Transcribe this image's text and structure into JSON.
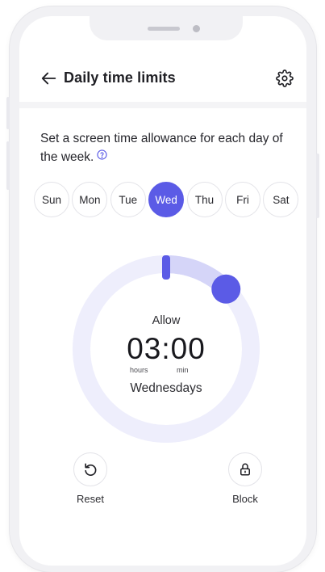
{
  "header": {
    "title": "Daily time limits",
    "back_icon": "arrow-left-icon",
    "settings_icon": "gear-icon"
  },
  "description": {
    "text": "Set a screen time allowance for each day of the week.",
    "help_icon": "question-circle-icon"
  },
  "days": [
    {
      "label": "Sun",
      "selected": false
    },
    {
      "label": "Mon",
      "selected": false
    },
    {
      "label": "Tue",
      "selected": false
    },
    {
      "label": "Wed",
      "selected": true
    },
    {
      "label": "Thu",
      "selected": false
    },
    {
      "label": "Fri",
      "selected": false
    },
    {
      "label": "Sat",
      "selected": false
    }
  ],
  "dial": {
    "allow_label": "Allow",
    "time": "03:00",
    "hours_label": "hours",
    "min_label": "min",
    "day_label": "Wednesdays",
    "allowance_fraction": 0.125
  },
  "actions": {
    "reset_label": "Reset",
    "block_label": "Block",
    "reset_icon": "undo-icon",
    "block_icon": "lock-icon"
  },
  "colors": {
    "accent": "#5b5be6",
    "track": "#eeeefc",
    "progress": "#d5d5f8"
  }
}
